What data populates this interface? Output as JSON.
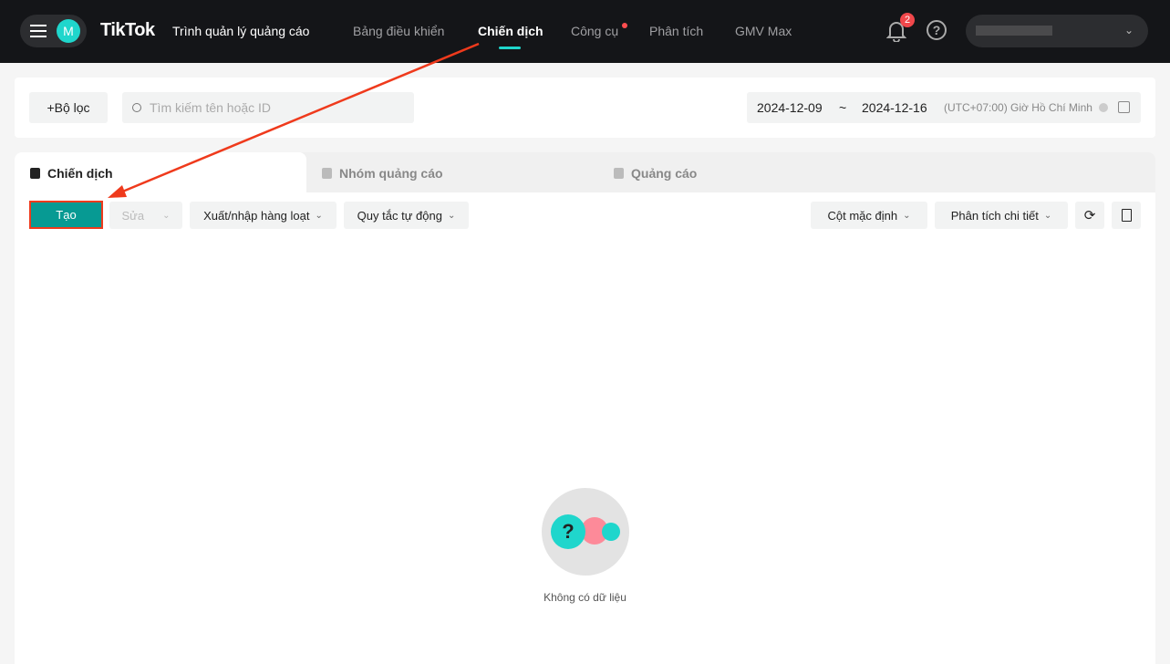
{
  "header": {
    "avatar_letter": "M",
    "logo": "TikTok",
    "product": "Trình quản lý quảng cáo",
    "nav": [
      "Bảng điều khiển",
      "Chiến dịch",
      "Công cụ",
      "Phân tích",
      "GMV Max"
    ],
    "notifications": "2",
    "help": "?"
  },
  "filter": {
    "add_filter": "+Bộ lọc",
    "search_placeholder": "Tìm kiếm tên hoặc ID",
    "date_start": "2024-12-09",
    "date_sep": "~",
    "date_end": "2024-12-16",
    "timezone": "(UTC+07:00) Giờ Hồ Chí Minh"
  },
  "tabs": [
    "Chiến dịch",
    "Nhóm quảng cáo",
    "Quảng cáo"
  ],
  "toolbar": {
    "create": "Tạo",
    "edit": "Sửa",
    "bulk": "Xuất/nhập hàng loạt",
    "rules": "Quy tắc tự động",
    "columns": "Cột mặc định",
    "breakdown": "Phân tích chi tiết"
  },
  "empty": {
    "text": "Không có dữ liệu"
  },
  "colors": {
    "accent": "#079a93",
    "highlight": "#ef3a1c"
  }
}
